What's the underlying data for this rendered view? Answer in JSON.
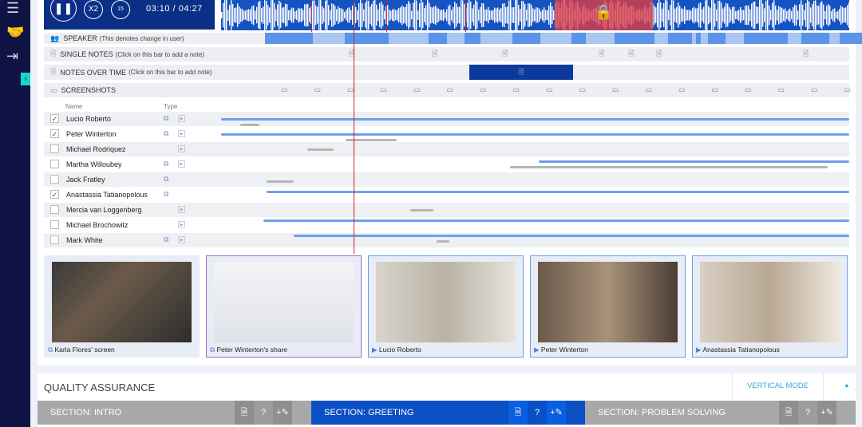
{
  "player": {
    "current_time": "03:10",
    "separator": "/",
    "total_time": "04:27",
    "speed_label": "X2",
    "skip_label": "15"
  },
  "tracks": {
    "speaker": {
      "label": "SPEAKER",
      "hint": "(This denotes change in user)"
    },
    "single_notes": {
      "label": "SINGLE NOTES",
      "hint": "(Click on this bar to add a note)"
    },
    "notes_over_time": {
      "label": "NOTES OVER TIME",
      "hint": "(Click on this bar to add note)"
    },
    "screenshots": {
      "label": "SCREENSHOTS"
    }
  },
  "participants_header": {
    "name": "Name",
    "type": "Type"
  },
  "participants": [
    {
      "name": "Lucio Roberto",
      "checked": true
    },
    {
      "name": "Peter Winterton",
      "checked": true
    },
    {
      "name": "Michael Rodriquez",
      "checked": false
    },
    {
      "name": "Martha Willoubey",
      "checked": false
    },
    {
      "name": "Jack Fratley",
      "checked": false
    },
    {
      "name": "Anastassia Tatianopolous",
      "checked": true
    },
    {
      "name": "Mercia van Loggenberg",
      "checked": false
    },
    {
      "name": "Michael Brochowitz",
      "checked": false
    },
    {
      "name": "Mark White",
      "checked": false
    }
  ],
  "thumbnails": [
    {
      "label": "Karla Flores' screen"
    },
    {
      "label": "Peter Winterton's share"
    },
    {
      "label": "Lucio Roberto"
    },
    {
      "label": "Peter Winterton"
    },
    {
      "label": "Anastassia Tatianopolous"
    }
  ],
  "qa": {
    "title": "QUALITY ASSURANCE",
    "vertical_mode": "VERTICAL MODE",
    "sections": [
      {
        "label": "SECTION: INTRO"
      },
      {
        "label": "SECTION: GREETING"
      },
      {
        "label": "SECTION: PROBLEM SOLVING"
      }
    ],
    "help": "?",
    "add": "+✎"
  },
  "colors": {
    "nav": "#0f1444",
    "primary": "#0b2f86",
    "wave": "#1553c3",
    "active": "#0a4fc4",
    "accent": "#19d6c6",
    "playhead": "#c0262b"
  }
}
